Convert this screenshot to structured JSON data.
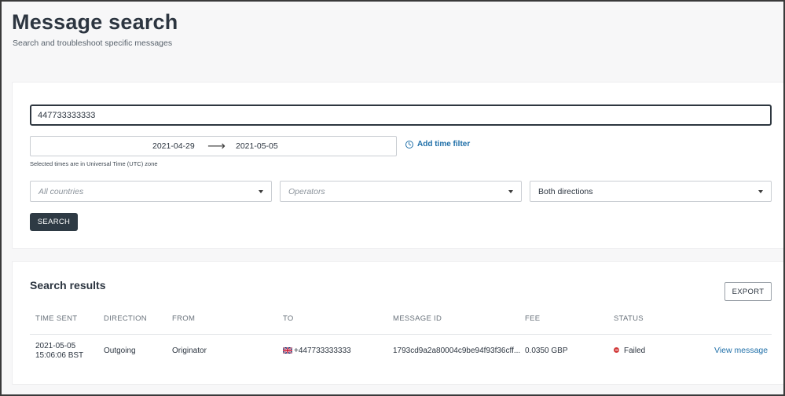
{
  "header": {
    "title": "Message search",
    "subtitle": "Search and troubleshoot specific messages"
  },
  "search": {
    "query_value": "447733333333",
    "date_from": "2021-04-29",
    "date_arrow": "⟶",
    "date_to": "2021-05-05",
    "add_time_filter_label": "Add time filter",
    "utc_note": "Selected times are in Universal Time (UTC) zone",
    "countries_placeholder": "All countries",
    "operators_placeholder": "Operators",
    "direction_value": "Both directions",
    "search_button": "SEARCH"
  },
  "results": {
    "title": "Search results",
    "export_button": "EXPORT",
    "columns": {
      "time_sent": "TIME SENT",
      "direction": "DIRECTION",
      "from": "FROM",
      "to": "TO",
      "message_id": "MESSAGE ID",
      "fee": "FEE",
      "status": "STATUS"
    },
    "rows": [
      {
        "time_date": "2021-05-05",
        "time_clock": "15:06:06 BST",
        "direction": "Outgoing",
        "from": "Originator",
        "to": "+447733333333",
        "message_id": "1793cd9a2a80004c9be94f93f36cff...",
        "fee": "0.0350 GBP",
        "status": "Failed",
        "action": "View message"
      }
    ]
  },
  "colors": {
    "accent_link": "#1f6fa8",
    "primary_button": "#2e3a44",
    "status_failed": "#d23a3a"
  }
}
